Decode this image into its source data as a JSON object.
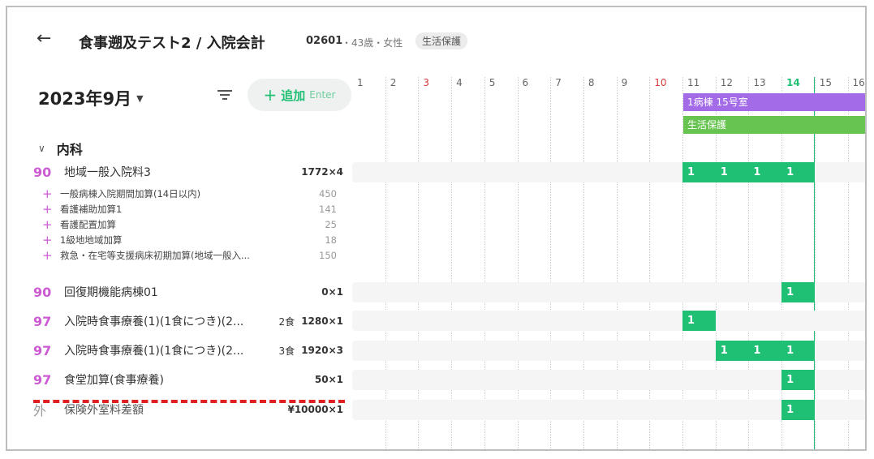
{
  "header": {
    "back_icon": "arrow-left-icon",
    "title": "食事遡及テスト2 / 入院会計",
    "patient_id": "02601",
    "patient_meta": "・43歳・女性",
    "badge": "生活保護"
  },
  "toolbar": {
    "month": "2023年9月",
    "add_label": "追加",
    "add_shortcut": "Enter"
  },
  "department": {
    "label": "内科"
  },
  "days": [
    "1",
    "2",
    "3",
    "4",
    "5",
    "6",
    "7",
    "8",
    "9",
    "10",
    "11",
    "12",
    "13",
    "14",
    "15",
    "16"
  ],
  "colors": {
    "accent": "#1fbf74",
    "room": "#a36be8",
    "welfare": "#68c450",
    "code": "#cc5bd3",
    "sunday": "#d93b3b"
  },
  "bars": {
    "room": "1病棟 15号室",
    "welfare": "生活保護"
  },
  "rows": [
    {
      "code": "90",
      "name": "地域一般入院料3",
      "count": "",
      "points": "1772×4",
      "marks": [
        "1",
        "1",
        "1",
        "1"
      ]
    },
    {
      "code": "90",
      "name": "回復期機能病棟01",
      "count": "",
      "points": "0×1",
      "marks": [
        "1"
      ]
    },
    {
      "code": "97",
      "name": "入院時食事療養(1)(1食につき)(2...",
      "count": "2食",
      "points": "1280×1",
      "marks": [
        "1"
      ]
    },
    {
      "code": "97",
      "name": "入院時食事療養(1)(1食につき)(2...",
      "count": "3食",
      "points": "1920×3",
      "marks": [
        "1",
        "1",
        "1"
      ]
    },
    {
      "code": "97",
      "name": "食堂加算(食事療養)",
      "count": "",
      "points": "50×1",
      "marks": [
        "1"
      ]
    },
    {
      "code": "外",
      "name": "保険外室料差額",
      "count": "",
      "points": "¥10000×1",
      "marks": [
        "1"
      ]
    }
  ],
  "subitems": [
    {
      "name": "一般病棟入院期間加算(14日以内)",
      "points": "450"
    },
    {
      "name": "看護補助加算1",
      "points": "141"
    },
    {
      "name": "看護配置加算",
      "points": "25"
    },
    {
      "name": "1級地地域加算",
      "points": "18"
    },
    {
      "name": "救急・在宅等支援病床初期加算(地域一般入...",
      "points": "150"
    }
  ]
}
